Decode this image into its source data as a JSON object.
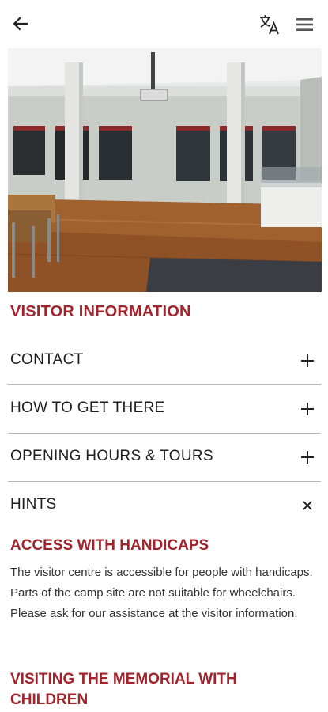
{
  "topbar": {
    "back_icon": "arrow-left-icon",
    "translate_icon": "translate-icon",
    "menu_icon": "hamburger-menu-icon"
  },
  "hero": {
    "image_desc": "photo"
  },
  "section": {
    "title": "VISITOR INFORMATION"
  },
  "accordion": {
    "items": [
      {
        "label": "CONTACT",
        "state_icon": "plus"
      },
      {
        "label": "HOW TO GET THERE",
        "state_icon": "plus"
      },
      {
        "label": "OPENING HOURS & TOURS",
        "state_icon": "plus"
      },
      {
        "label": "HINTS",
        "state_icon": "close"
      }
    ]
  },
  "hints": {
    "access_title": "ACCESS WITH HANDICAPS",
    "access_text": "The visitor centre is accessible for people with handicaps. Parts of the camp site are not suitable for wheelchairs. Please ask for our assistance at the visitor information.",
    "children_title": "VISITING THE MEMORIAL WITH CHILDREN"
  },
  "colors": {
    "accent": "#a1232b",
    "divider": "#b8b8b8"
  }
}
